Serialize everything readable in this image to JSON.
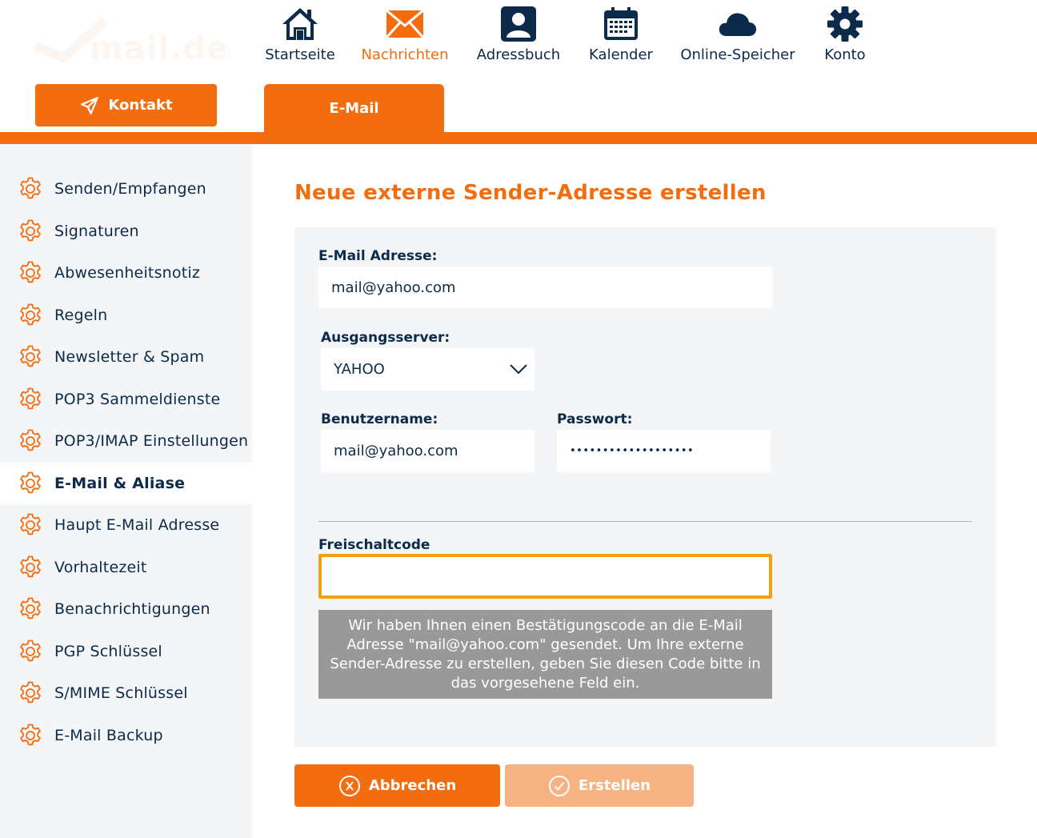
{
  "brand": {
    "logo_text": "mail.de",
    "accent_color": "#f36c0e",
    "navy_color": "#0c2a4a",
    "focus_color": "#f4a012"
  },
  "header": {
    "contact_button": {
      "label": "Kontakt",
      "icon": "paper-plane-icon"
    },
    "nav": [
      {
        "label": "Startseite",
        "icon": "home-icon",
        "active": false
      },
      {
        "label": "Nachrichten",
        "icon": "envelope-icon",
        "active": true
      },
      {
        "label": "Adressbuch",
        "icon": "contact-card-icon",
        "active": false
      },
      {
        "label": "Kalender",
        "icon": "calendar-icon",
        "active": false
      },
      {
        "label": "Online-Speicher",
        "icon": "cloud-icon",
        "active": false
      },
      {
        "label": "Konto",
        "icon": "gear-icon",
        "active": false
      }
    ],
    "subtab": {
      "label": "E-Mail"
    }
  },
  "sidebar": {
    "items": [
      {
        "label": "Senden/Empfangen",
        "active": false
      },
      {
        "label": "Signaturen",
        "active": false
      },
      {
        "label": "Abwesenheitsnotiz",
        "active": false
      },
      {
        "label": "Regeln",
        "active": false
      },
      {
        "label": "Newsletter & Spam",
        "active": false
      },
      {
        "label": "POP3 Sammeldienste",
        "active": false
      },
      {
        "label": "POP3/IMAP Einstellungen",
        "active": false
      },
      {
        "label": "E-Mail & Aliase",
        "active": true
      },
      {
        "label": "Haupt E-Mail Adresse",
        "active": false
      },
      {
        "label": "Vorhaltezeit",
        "active": false
      },
      {
        "label": "Benachrichtigungen",
        "active": false
      },
      {
        "label": "PGP Schlüssel",
        "active": false
      },
      {
        "label": "S/MIME Schlüssel",
        "active": false
      },
      {
        "label": "E-Mail Backup",
        "active": false
      }
    ]
  },
  "main": {
    "title": "Neue externe Sender-Adresse erstellen",
    "email": {
      "label": "E-Mail Adresse:",
      "value": "mail@yahoo.com"
    },
    "server": {
      "label": "Ausgangsserver:",
      "value": "YAHOO"
    },
    "username": {
      "label": "Benutzername:",
      "value": "mail@yahoo.com"
    },
    "password": {
      "label": "Passwort:",
      "value": "•••••••••••••••••••"
    },
    "code": {
      "label": "Freischaltcode",
      "value": ""
    },
    "info": "Wir haben Ihnen einen Bestätigungscode an die E-Mail Adresse \"mail@yahoo.com\" gesendet. Um Ihre externe Sender-Adresse zu erstellen, geben Sie diesen Code bitte in das vorgesehene Feld ein.",
    "cancel_button": {
      "label": "Abbrechen",
      "icon": "x-circle-icon"
    },
    "create_button": {
      "label": "Erstellen",
      "icon": "check-circle-icon",
      "enabled": false
    }
  }
}
